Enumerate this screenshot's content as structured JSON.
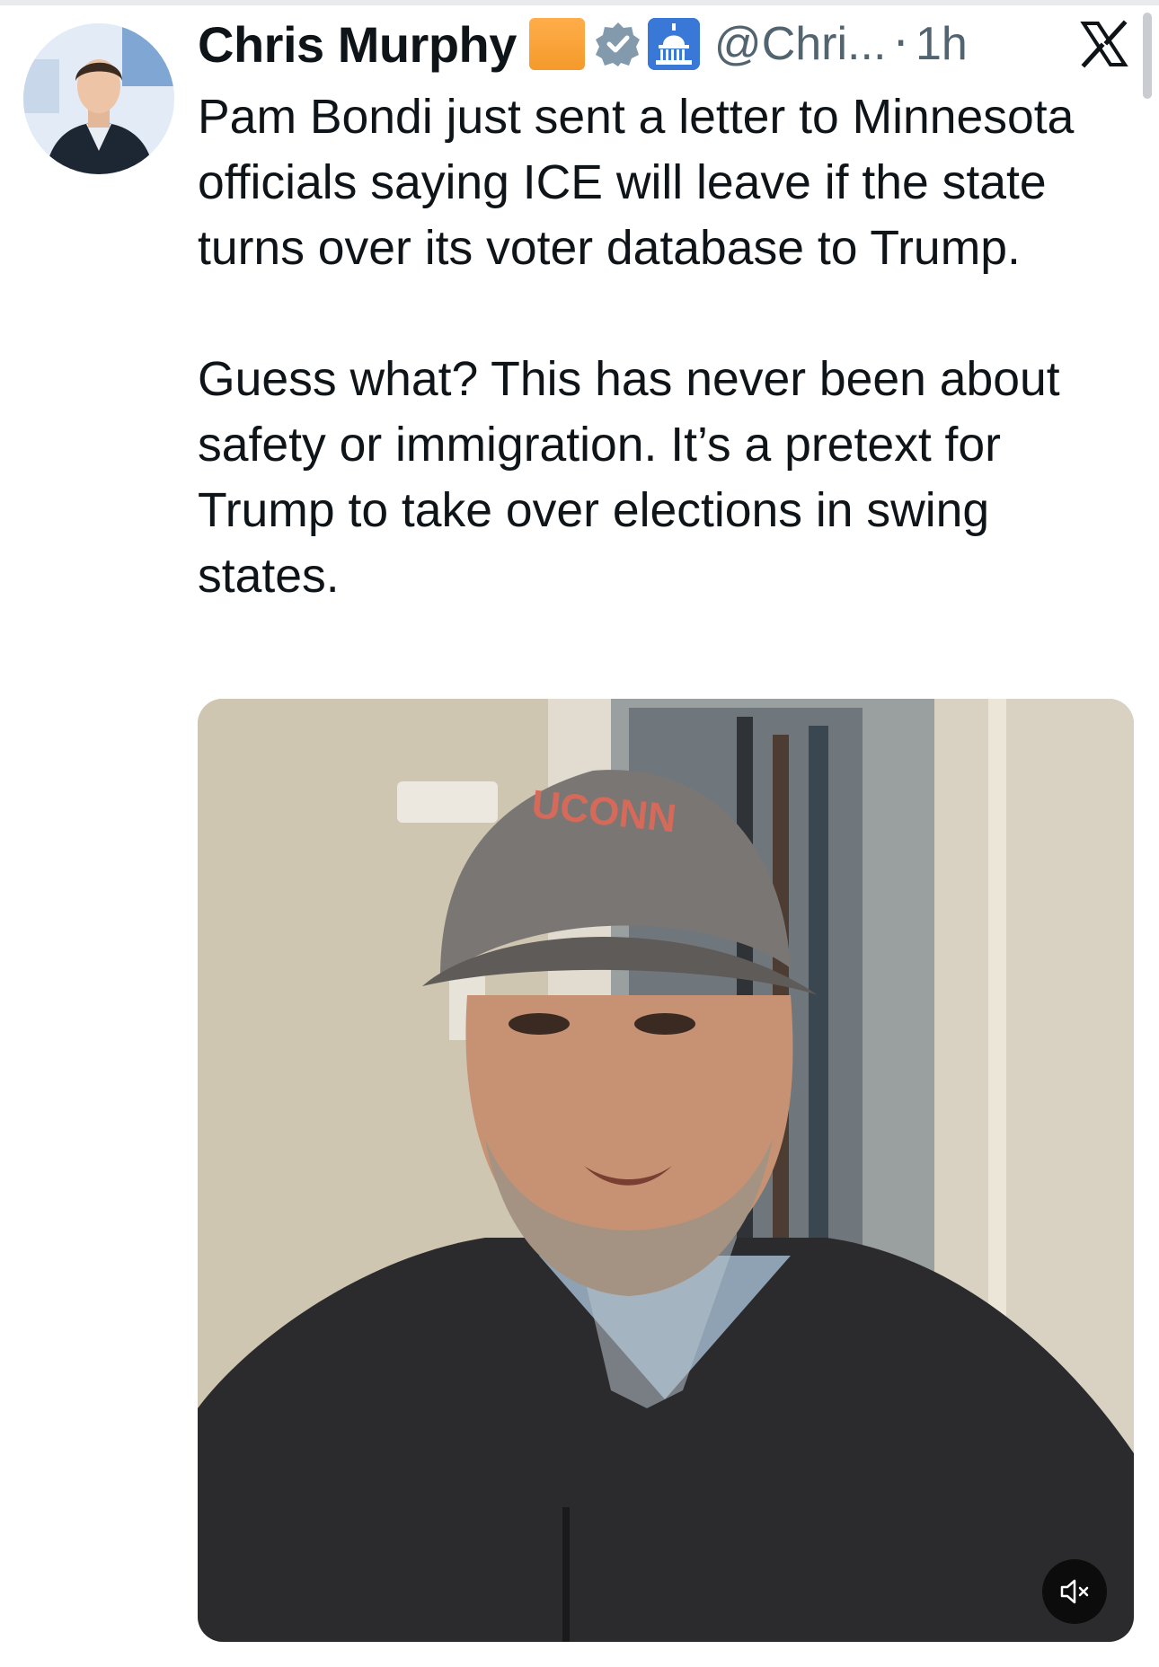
{
  "post": {
    "author_name": "Chris Murphy",
    "handle": "@Chri...",
    "separator": "·",
    "time": "1h",
    "paragraph_1": "Pam Bondi just sent a letter to Minnesota officials saying ICE will leave if the state turns over its voter database to Trump.",
    "paragraph_2": "Guess what? This has never been about safety or immigration. It’s a pretext for Trump to take over elections in swing states."
  },
  "video": {
    "cap_text": "UCONN",
    "mute_icon": "speaker-muted-icon"
  },
  "icons": {
    "close": "x-logo-icon",
    "verified": "verified-badge-icon",
    "capitol": "capitol-badge-icon",
    "square": "orange-square-badge"
  },
  "colors": {
    "text": "#0f1419",
    "secondary": "#536471",
    "verified": "#829aab",
    "badge_orange": "#f59a2b",
    "capitol_blue": "#3a78d8"
  }
}
